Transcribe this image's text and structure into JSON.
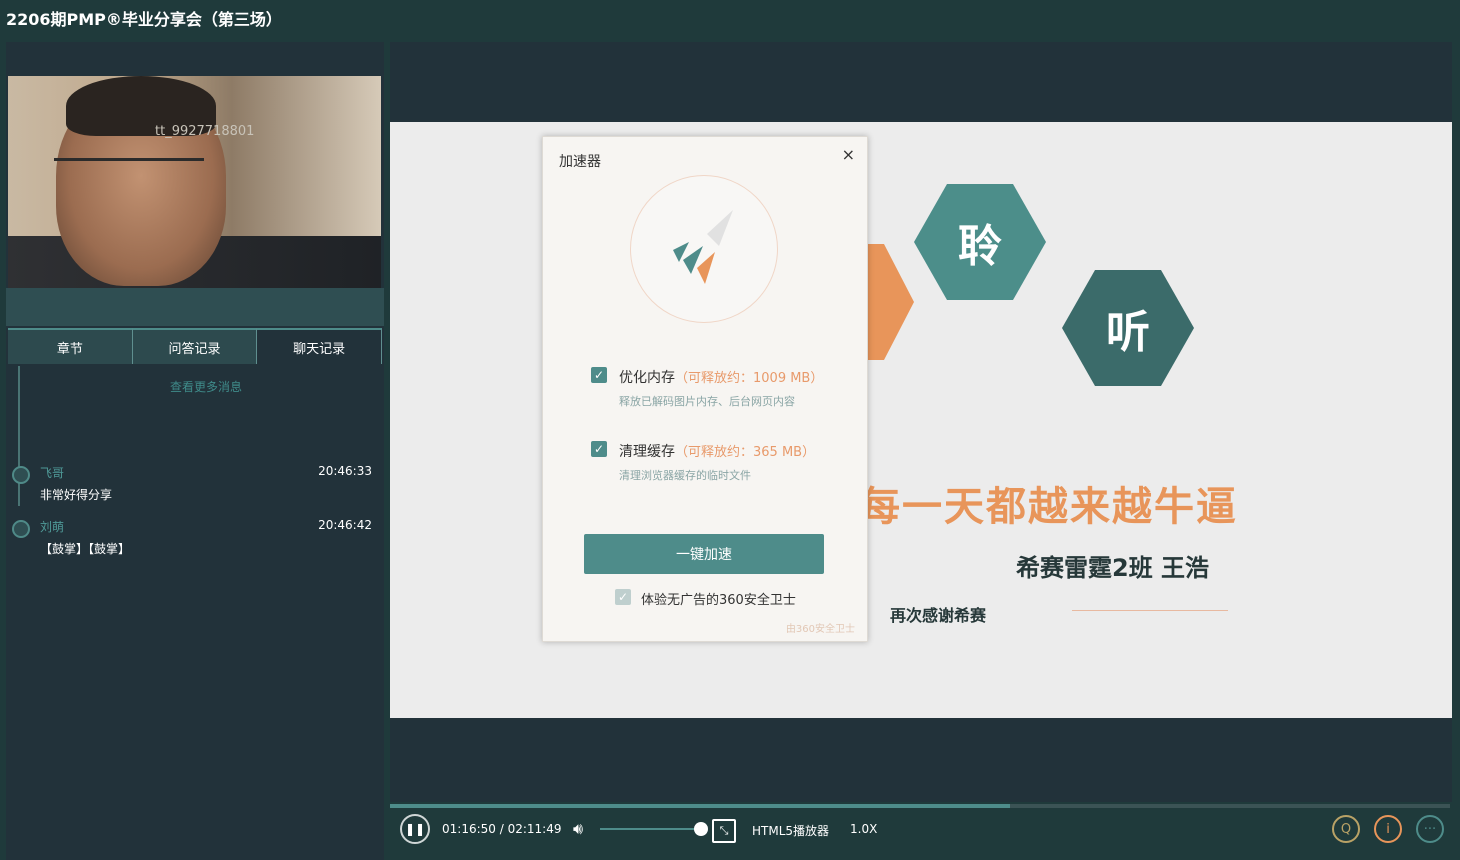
{
  "window": {
    "title": "2206期PMP®毕业分享会（第三场）"
  },
  "video": {
    "watermark": "tt_9927718801"
  },
  "tabs": [
    {
      "label": "章节"
    },
    {
      "label": "问答记录"
    },
    {
      "label": "聊天记录",
      "active": true
    }
  ],
  "chat": {
    "notice": "查看更多消息",
    "messages": [
      {
        "name": "飞哥",
        "time": "20:46:33",
        "text": "非常好得分享"
      },
      {
        "name": "刘萌",
        "time": "20:46:42",
        "text": "【鼓掌】【鼓掌】"
      }
    ]
  },
  "slide": {
    "hex_text_1": "聆",
    "hex_text_2": "听",
    "slogan": "每一天都越来越牛逼",
    "presenter": "希赛雷霆2班 王浩",
    "thanks": "再次感谢希赛"
  },
  "dialog": {
    "title": "加速器",
    "close": "×",
    "options": [
      {
        "label": "优化内存",
        "save": "（可释放约：1009 MB）",
        "desc": "释放已解码图片内存、后台网页内容",
        "checked": true
      },
      {
        "label": "清理缓存",
        "save": "（可释放约：365 MB）",
        "desc": "清理浏览器缓存的临时文件",
        "checked": true
      }
    ],
    "button": "一键加速",
    "ad_label": "体验无广告的360安全卫士",
    "brand": "由360安全卫士"
  },
  "player": {
    "progress": 0.585,
    "time": "01:16:50 / 02:11:49",
    "volume": 1.0,
    "name": "HTML5播放器",
    "speed": "1.0X"
  },
  "icons": [
    "pause-icon",
    "volume-icon",
    "fullscreen-icon",
    "search-icon",
    "info-icon",
    "more-icon",
    "rocket-icon",
    "checkbox-icon"
  ],
  "colors": {
    "teal": "#4e8c8a",
    "orange": "#e8955a",
    "dark_bg": "#22323a",
    "title_bg": "#1f3a3b"
  }
}
